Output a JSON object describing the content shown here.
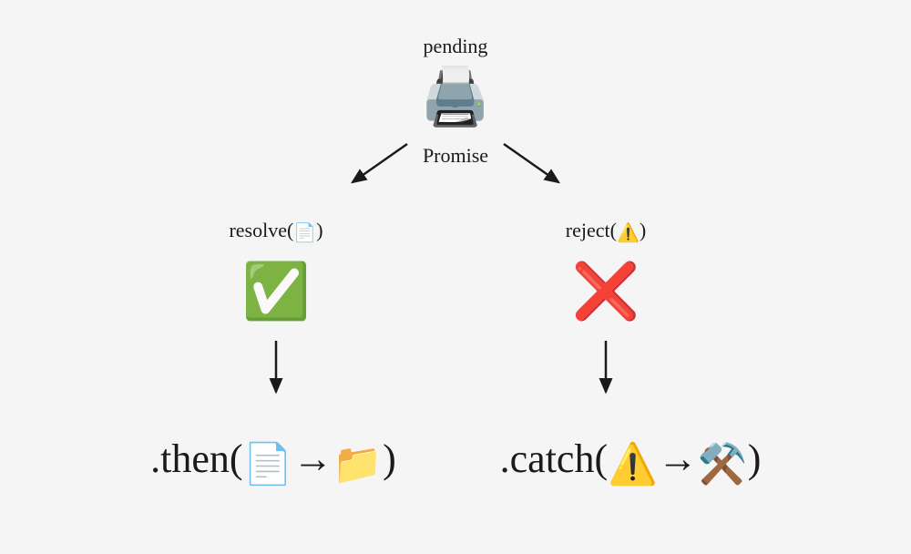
{
  "top": {
    "pending": "pending",
    "promise": "Promise",
    "printer_emoji": "🖨️"
  },
  "left": {
    "resolve_prefix": "resolve(",
    "resolve_emoji": "📄",
    "resolve_suffix": ")",
    "check_emoji": "✅",
    "then_prefix": ".then(",
    "then_arg1": "📄",
    "then_arrow": "→",
    "then_arg2": "📁",
    "then_suffix": ")"
  },
  "right": {
    "reject_prefix": "reject(",
    "reject_emoji": "⚠️",
    "reject_suffix": ")",
    "cross_emoji": "❌",
    "catch_prefix": ".catch(",
    "catch_arg1": "⚠️",
    "catch_arrow": "→",
    "catch_arg2": "⚒️",
    "catch_suffix": ")"
  }
}
